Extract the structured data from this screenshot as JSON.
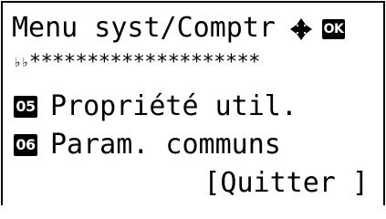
{
  "screen": {
    "title": "Menu syst/Comptr",
    "nav_icon": "four-way-arrow-icon",
    "ok_label": "OK",
    "progress_stars": "********************",
    "progress_prefix": "♭♭",
    "items": [
      {
        "number": "05",
        "label": "Propriété util."
      },
      {
        "number": "06",
        "label": "Param. communs"
      }
    ],
    "softkey_label": "[Quitter ]"
  }
}
